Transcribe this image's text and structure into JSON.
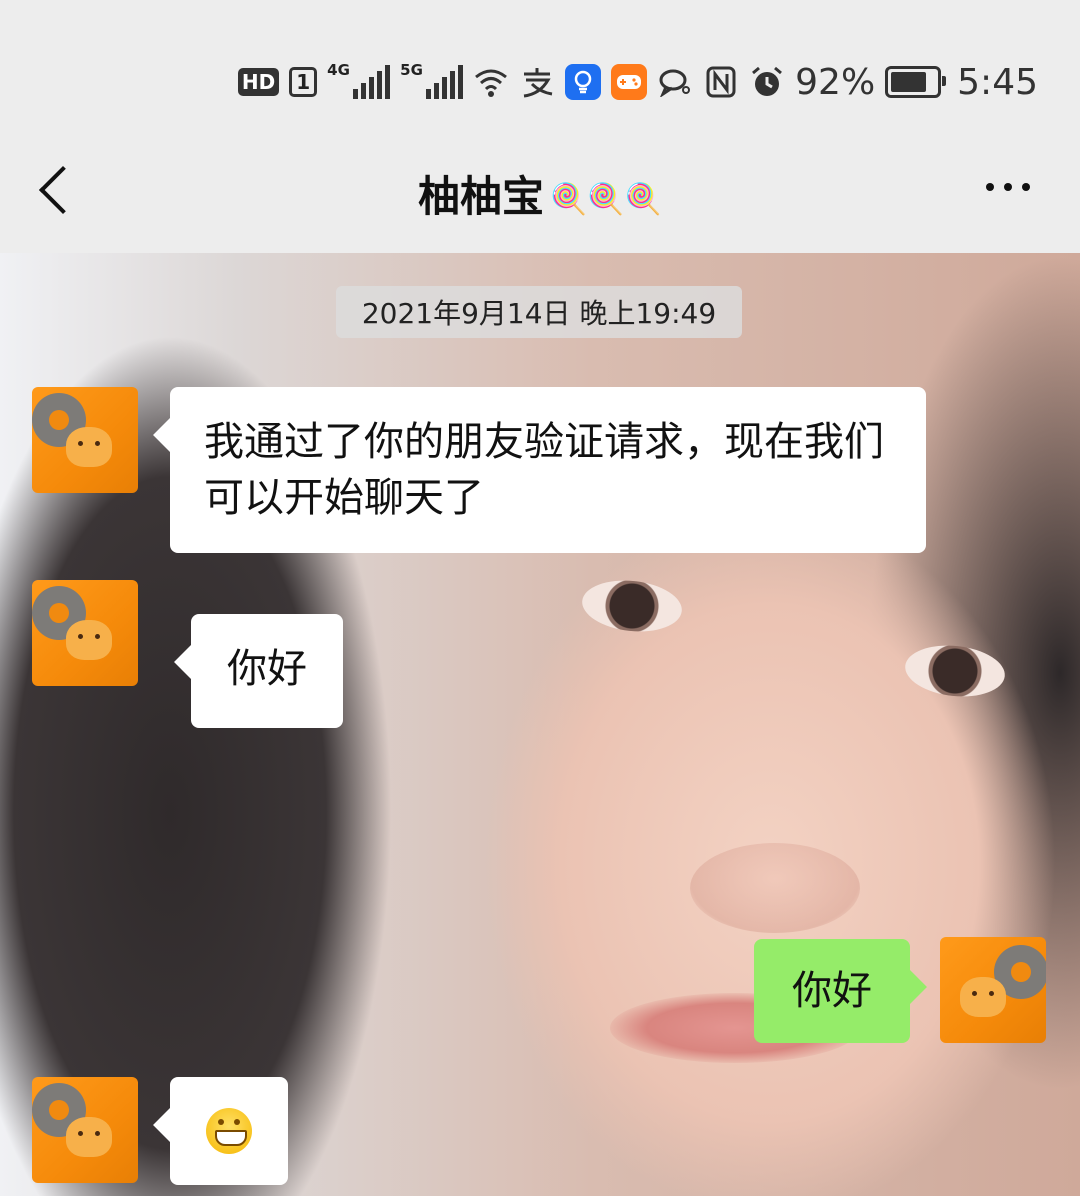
{
  "status_bar": {
    "hd_label": "HD",
    "sim_label": "1",
    "net1_tag": "4G",
    "net2_tag": "5G",
    "battery_percent": "92%",
    "battery_level": 0.92,
    "time": "5:45",
    "icons": [
      "hd-icon",
      "sim-icon",
      "signal-4g-icon",
      "signal-5g-icon",
      "wifi-icon",
      "alipay-icon",
      "bulb-app-icon",
      "game-app-icon",
      "bubble-icon",
      "nfc-icon",
      "alarm-icon",
      "battery-icon"
    ]
  },
  "nav": {
    "title": "柚柚宝",
    "title_emoji": "🍭🍭🍭",
    "back_icon": "chevron-left-icon",
    "more_icon": "more-dots-icon"
  },
  "chat": {
    "timestamp": "2021年9月14日 晚上19:49",
    "messages": [
      {
        "side": "left",
        "text": "我通过了你的朋友验证请求，现在我们可以开始聊天了"
      },
      {
        "side": "left",
        "text": "你好"
      },
      {
        "side": "right",
        "text": "你好"
      },
      {
        "side": "left",
        "emoji": "grinning-face-icon"
      }
    ]
  },
  "colors": {
    "bar_bg": "#ededed",
    "bubble_self": "#95ec69",
    "bubble_other": "#ffffff",
    "avatar_orange": "#f58a0a"
  }
}
